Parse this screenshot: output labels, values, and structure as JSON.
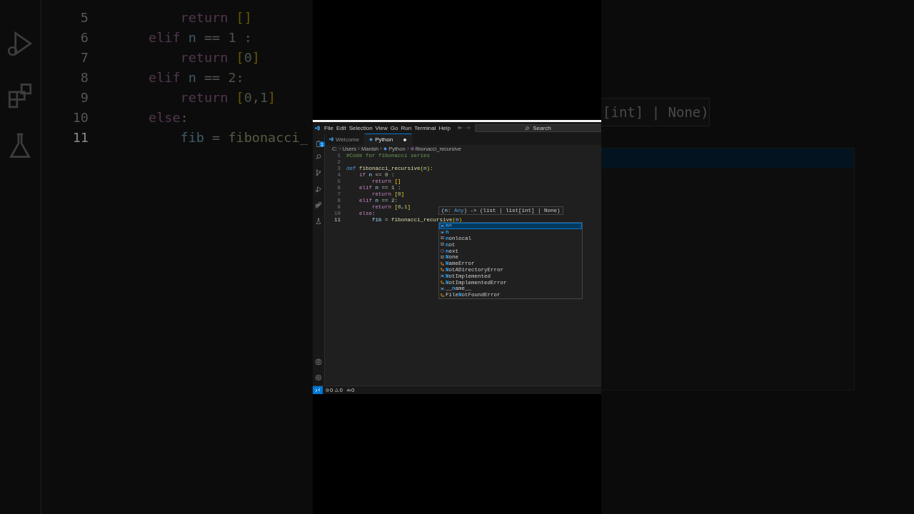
{
  "backdrop_left": {
    "lines": [
      {
        "number": "5",
        "active": false,
        "tokens": [
          {
            "kind": "control",
            "text": "    return"
          },
          {
            "kind": "bracket",
            "text": " []"
          }
        ]
      },
      {
        "number": "6",
        "active": false,
        "tokens": [
          {
            "kind": "control",
            "text": "elif"
          },
          {
            "kind": "param",
            "text": " n"
          },
          {
            "kind": "plain",
            "text": " =="
          },
          {
            "kind": "number",
            "text": " 1"
          },
          {
            "kind": "plain",
            "text": " :"
          }
        ]
      },
      {
        "number": "7",
        "active": false,
        "tokens": [
          {
            "kind": "control",
            "text": "    return"
          },
          {
            "kind": "bracket",
            "text": " ["
          },
          {
            "kind": "number",
            "text": "0"
          },
          {
            "kind": "bracket",
            "text": "]"
          }
        ]
      },
      {
        "number": "8",
        "active": false,
        "tokens": [
          {
            "kind": "control",
            "text": "elif"
          },
          {
            "kind": "param",
            "text": " n"
          },
          {
            "kind": "plain",
            "text": " =="
          },
          {
            "kind": "number",
            "text": " 2"
          },
          {
            "kind": "plain",
            "text": ":"
          }
        ]
      },
      {
        "number": "9",
        "active": false,
        "tokens": [
          {
            "kind": "control",
            "text": "    return"
          },
          {
            "kind": "bracket",
            "text": " ["
          },
          {
            "kind": "number",
            "text": "0"
          },
          {
            "kind": "plain",
            "text": ","
          },
          {
            "kind": "number",
            "text": "1"
          },
          {
            "kind": "bracket",
            "text": "]"
          }
        ]
      },
      {
        "number": "10",
        "active": false,
        "tokens": [
          {
            "kind": "control",
            "text": "else"
          },
          {
            "kind": "plain",
            "text": ":"
          }
        ]
      },
      {
        "number": "11",
        "active": true,
        "tokens": [
          {
            "kind": "var",
            "text": "    fib"
          },
          {
            "kind": "plain",
            "text": " ="
          },
          {
            "kind": "function",
            "text": " fibonacci_"
          }
        ]
      }
    ]
  },
  "backdrop_right": {
    "hint": "[int] | None)"
  },
  "window": {
    "menu": [
      "File",
      "Edit",
      "Selection",
      "View",
      "Go",
      "Run",
      "Terminal",
      "Help"
    ],
    "search": {
      "placeholder": "Search"
    },
    "activity": {
      "explorer_badge": "1"
    },
    "tabs": [
      {
        "label": "Welcome",
        "selected": false,
        "dirty": false
      },
      {
        "label": "Python",
        "selected": true,
        "dirty": true
      }
    ],
    "breadcrumbs": [
      "C:",
      "Users",
      "Manish",
      "Python",
      "fibonacci_recursive"
    ],
    "editor": {
      "lines": [
        {
          "number": "1",
          "active": false,
          "tokens": [
            {
              "kind": "comment",
              "text": "#Code for fibonacci series"
            }
          ]
        },
        {
          "number": "2",
          "active": false
        },
        {
          "number": "3",
          "active": false,
          "tokens": [
            {
              "kind": "keyword",
              "text": "def"
            },
            {
              "kind": "function",
              "text": " fibonacci_recursive"
            },
            {
              "kind": "bracket",
              "text": "("
            },
            {
              "kind": "param",
              "text": "n"
            },
            {
              "kind": "bracket",
              "text": ")"
            },
            {
              "kind": "plain",
              "text": ":"
            }
          ]
        },
        {
          "number": "4",
          "active": false,
          "tokens": [
            {
              "kind": "control",
              "text": "    if"
            },
            {
              "kind": "param",
              "text": " n"
            },
            {
              "kind": "plain",
              "text": " <="
            },
            {
              "kind": "number",
              "text": " 0"
            },
            {
              "kind": "plain",
              "text": " :"
            }
          ]
        },
        {
          "number": "5",
          "active": false,
          "tokens": [
            {
              "kind": "control",
              "text": "        return"
            },
            {
              "kind": "bracket",
              "text": " []"
            }
          ]
        },
        {
          "number": "6",
          "active": false,
          "tokens": [
            {
              "kind": "control",
              "text": "    elif"
            },
            {
              "kind": "param",
              "text": " n"
            },
            {
              "kind": "plain",
              "text": " =="
            },
            {
              "kind": "number",
              "text": " 1"
            },
            {
              "kind": "plain",
              "text": " :"
            }
          ]
        },
        {
          "number": "7",
          "active": false,
          "tokens": [
            {
              "kind": "control",
              "text": "        return"
            },
            {
              "kind": "bracket",
              "text": " ["
            },
            {
              "kind": "number",
              "text": "0"
            },
            {
              "kind": "bracket",
              "text": "]"
            }
          ]
        },
        {
          "number": "8",
          "active": false,
          "tokens": [
            {
              "kind": "control",
              "text": "    elif"
            },
            {
              "kind": "param",
              "text": " n"
            },
            {
              "kind": "plain",
              "text": " =="
            },
            {
              "kind": "number",
              "text": " 2"
            },
            {
              "kind": "plain",
              "text": ":"
            }
          ]
        },
        {
          "number": "9",
          "active": false,
          "tokens": [
            {
              "kind": "control",
              "text": "        return"
            },
            {
              "kind": "bracket",
              "text": " ["
            },
            {
              "kind": "number",
              "text": "0"
            },
            {
              "kind": "plain",
              "text": ","
            },
            {
              "kind": "number",
              "text": "1"
            },
            {
              "kind": "bracket",
              "text": "]"
            }
          ]
        },
        {
          "number": "10",
          "active": false,
          "tokens": [
            {
              "kind": "control",
              "text": "    else"
            },
            {
              "kind": "plain",
              "text": ":"
            }
          ]
        },
        {
          "number": "11",
          "active": true,
          "tokens": [
            {
              "kind": "var",
              "text": "        fib"
            },
            {
              "kind": "plain",
              "text": " ="
            },
            {
              "kind": "function",
              "text": " fibonacci_recursive"
            },
            {
              "kind": "bracket",
              "text": "("
            },
            {
              "kind": "param",
              "text": "n"
            },
            {
              "kind": "bracket",
              "text": ")"
            }
          ]
        }
      ]
    },
    "signature_hint": {
      "tokens": [
        {
          "kind": "plain",
          "text": "("
        },
        {
          "kind": "param",
          "text": "n"
        },
        {
          "kind": "plain",
          "text": ":"
        },
        {
          "kind": "keyword",
          "text": " Any"
        },
        {
          "kind": "plain",
          "text": ") -> (list | list[int] | None)"
        }
      ]
    },
    "suggestions": [
      {
        "kind": "variable",
        "match": "n",
        "after": "=",
        "selected": true
      },
      {
        "kind": "variable",
        "match": "n",
        "selected": false
      },
      {
        "kind": "keyword",
        "match": "n",
        "after": "onlocal",
        "selected": false
      },
      {
        "kind": "keyword",
        "match": "n",
        "after": "ot",
        "selected": false
      },
      {
        "kind": "function",
        "match": "n",
        "after": "ext",
        "selected": false
      },
      {
        "kind": "keyword",
        "match": "N",
        "after": "one",
        "selected": false
      },
      {
        "kind": "class",
        "match": "N",
        "after": "ameError",
        "selected": false
      },
      {
        "kind": "class",
        "match": "N",
        "after": "otADirectoryError",
        "selected": false
      },
      {
        "kind": "variable",
        "match": "N",
        "after": "otImplemented",
        "selected": false
      },
      {
        "kind": "class",
        "match": "N",
        "after": "otImplementedError",
        "selected": false
      },
      {
        "kind": "variable",
        "before": "__",
        "match": "n",
        "after": "ame__",
        "selected": false
      },
      {
        "kind": "class",
        "before": "File",
        "match": "N",
        "after": "otFoundError",
        "selected": false
      }
    ],
    "status_bar": {
      "errors": "0",
      "warnings": "0",
      "ports": "0"
    }
  }
}
